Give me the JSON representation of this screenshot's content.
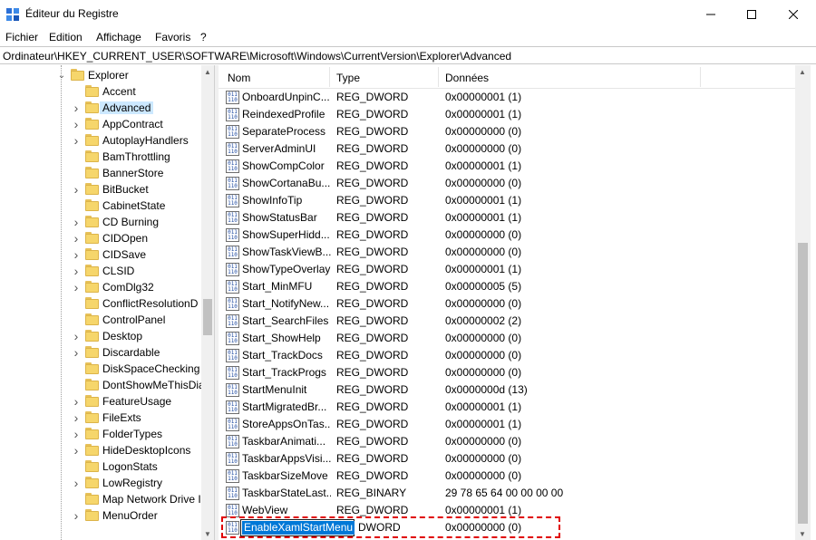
{
  "window": {
    "title": "Éditeur du Registre",
    "icon": "registry-editor-icon",
    "controls": [
      "minimize-icon",
      "maximize-icon",
      "close-icon"
    ]
  },
  "menu": [
    {
      "label": "Fichier"
    },
    {
      "label": "Edition"
    },
    {
      "label": "Affichage"
    },
    {
      "label": "Favoris"
    },
    {
      "label": "?"
    }
  ],
  "address": "Ordinateur\\HKEY_CURRENT_USER\\SOFTWARE\\Microsoft\\Windows\\CurrentVersion\\Explorer\\Advanced",
  "tree": {
    "parent": {
      "label": "Explorer",
      "expanded": true
    },
    "items": [
      {
        "label": "Accent",
        "expandable": false,
        "selected": false
      },
      {
        "label": "Advanced",
        "expandable": true,
        "selected": true
      },
      {
        "label": "AppContract",
        "expandable": true,
        "selected": false
      },
      {
        "label": "AutoplayHandlers",
        "expandable": true,
        "selected": false
      },
      {
        "label": "BamThrottling",
        "expandable": false,
        "selected": false
      },
      {
        "label": "BannerStore",
        "expandable": false,
        "selected": false
      },
      {
        "label": "BitBucket",
        "expandable": true,
        "selected": false
      },
      {
        "label": "CabinetState",
        "expandable": false,
        "selected": false
      },
      {
        "label": "CD Burning",
        "expandable": true,
        "selected": false
      },
      {
        "label": "CIDOpen",
        "expandable": true,
        "selected": false
      },
      {
        "label": "CIDSave",
        "expandable": true,
        "selected": false
      },
      {
        "label": "CLSID",
        "expandable": true,
        "selected": false
      },
      {
        "label": "ComDlg32",
        "expandable": true,
        "selected": false
      },
      {
        "label": "ConflictResolutionD",
        "expandable": false,
        "selected": false
      },
      {
        "label": "ControlPanel",
        "expandable": false,
        "selected": false
      },
      {
        "label": "Desktop",
        "expandable": true,
        "selected": false
      },
      {
        "label": "Discardable",
        "expandable": true,
        "selected": false
      },
      {
        "label": "DiskSpaceChecking",
        "expandable": false,
        "selected": false
      },
      {
        "label": "DontShowMeThisDia",
        "expandable": false,
        "selected": false
      },
      {
        "label": "FeatureUsage",
        "expandable": true,
        "selected": false
      },
      {
        "label": "FileExts",
        "expandable": true,
        "selected": false
      },
      {
        "label": "FolderTypes",
        "expandable": true,
        "selected": false
      },
      {
        "label": "HideDesktopIcons",
        "expandable": true,
        "selected": false
      },
      {
        "label": "LogonStats",
        "expandable": false,
        "selected": false
      },
      {
        "label": "LowRegistry",
        "expandable": true,
        "selected": false
      },
      {
        "label": "Map Network Drive I",
        "expandable": false,
        "selected": false
      },
      {
        "label": "MenuOrder",
        "expandable": true,
        "selected": false
      }
    ]
  },
  "list": {
    "columns": {
      "name": "Nom",
      "type": "Type",
      "data": "Données"
    },
    "rows": [
      {
        "name": "OnboardUnpinC...",
        "type": "REG_DWORD",
        "data": "0x00000001 (1)"
      },
      {
        "name": "ReindexedProfile",
        "type": "REG_DWORD",
        "data": "0x00000001 (1)"
      },
      {
        "name": "SeparateProcess",
        "type": "REG_DWORD",
        "data": "0x00000000 (0)"
      },
      {
        "name": "ServerAdminUI",
        "type": "REG_DWORD",
        "data": "0x00000000 (0)"
      },
      {
        "name": "ShowCompColor",
        "type": "REG_DWORD",
        "data": "0x00000001 (1)"
      },
      {
        "name": "ShowCortanaBu...",
        "type": "REG_DWORD",
        "data": "0x00000000 (0)"
      },
      {
        "name": "ShowInfoTip",
        "type": "REG_DWORD",
        "data": "0x00000001 (1)"
      },
      {
        "name": "ShowStatusBar",
        "type": "REG_DWORD",
        "data": "0x00000001 (1)"
      },
      {
        "name": "ShowSuperHidd...",
        "type": "REG_DWORD",
        "data": "0x00000000 (0)"
      },
      {
        "name": "ShowTaskViewB...",
        "type": "REG_DWORD",
        "data": "0x00000000 (0)"
      },
      {
        "name": "ShowTypeOverlay",
        "type": "REG_DWORD",
        "data": "0x00000001 (1)"
      },
      {
        "name": "Start_MinMFU",
        "type": "REG_DWORD",
        "data": "0x00000005 (5)"
      },
      {
        "name": "Start_NotifyNew...",
        "type": "REG_DWORD",
        "data": "0x00000000 (0)"
      },
      {
        "name": "Start_SearchFiles",
        "type": "REG_DWORD",
        "data": "0x00000002 (2)"
      },
      {
        "name": "Start_ShowHelp",
        "type": "REG_DWORD",
        "data": "0x00000000 (0)"
      },
      {
        "name": "Start_TrackDocs",
        "type": "REG_DWORD",
        "data": "0x00000000 (0)"
      },
      {
        "name": "Start_TrackProgs",
        "type": "REG_DWORD",
        "data": "0x00000000 (0)"
      },
      {
        "name": "StartMenuInit",
        "type": "REG_DWORD",
        "data": "0x0000000d (13)"
      },
      {
        "name": "StartMigratedBr...",
        "type": "REG_DWORD",
        "data": "0x00000001 (1)"
      },
      {
        "name": "StoreAppsOnTas...",
        "type": "REG_DWORD",
        "data": "0x00000001 (1)"
      },
      {
        "name": "TaskbarAnimati...",
        "type": "REG_DWORD",
        "data": "0x00000000 (0)"
      },
      {
        "name": "TaskbarAppsVisi...",
        "type": "REG_DWORD",
        "data": "0x00000000 (0)"
      },
      {
        "name": "TaskbarSizeMove",
        "type": "REG_DWORD",
        "data": "0x00000000 (0)"
      },
      {
        "name": "TaskbarStateLast...",
        "type": "REG_BINARY",
        "data": "29 78 65 64 00 00 00 00"
      },
      {
        "name": "WebView",
        "type": "REG_DWORD",
        "data": "0x00000001 (1)"
      },
      {
        "name": "EnableXamlStartMenu",
        "type": "DWORD",
        "data": "0x00000000 (0)",
        "editing": true
      }
    ]
  },
  "colors": {
    "selection": "#0078d7",
    "tree_selected_bg": "#cce8ff",
    "highlight_border": "#e00000"
  }
}
